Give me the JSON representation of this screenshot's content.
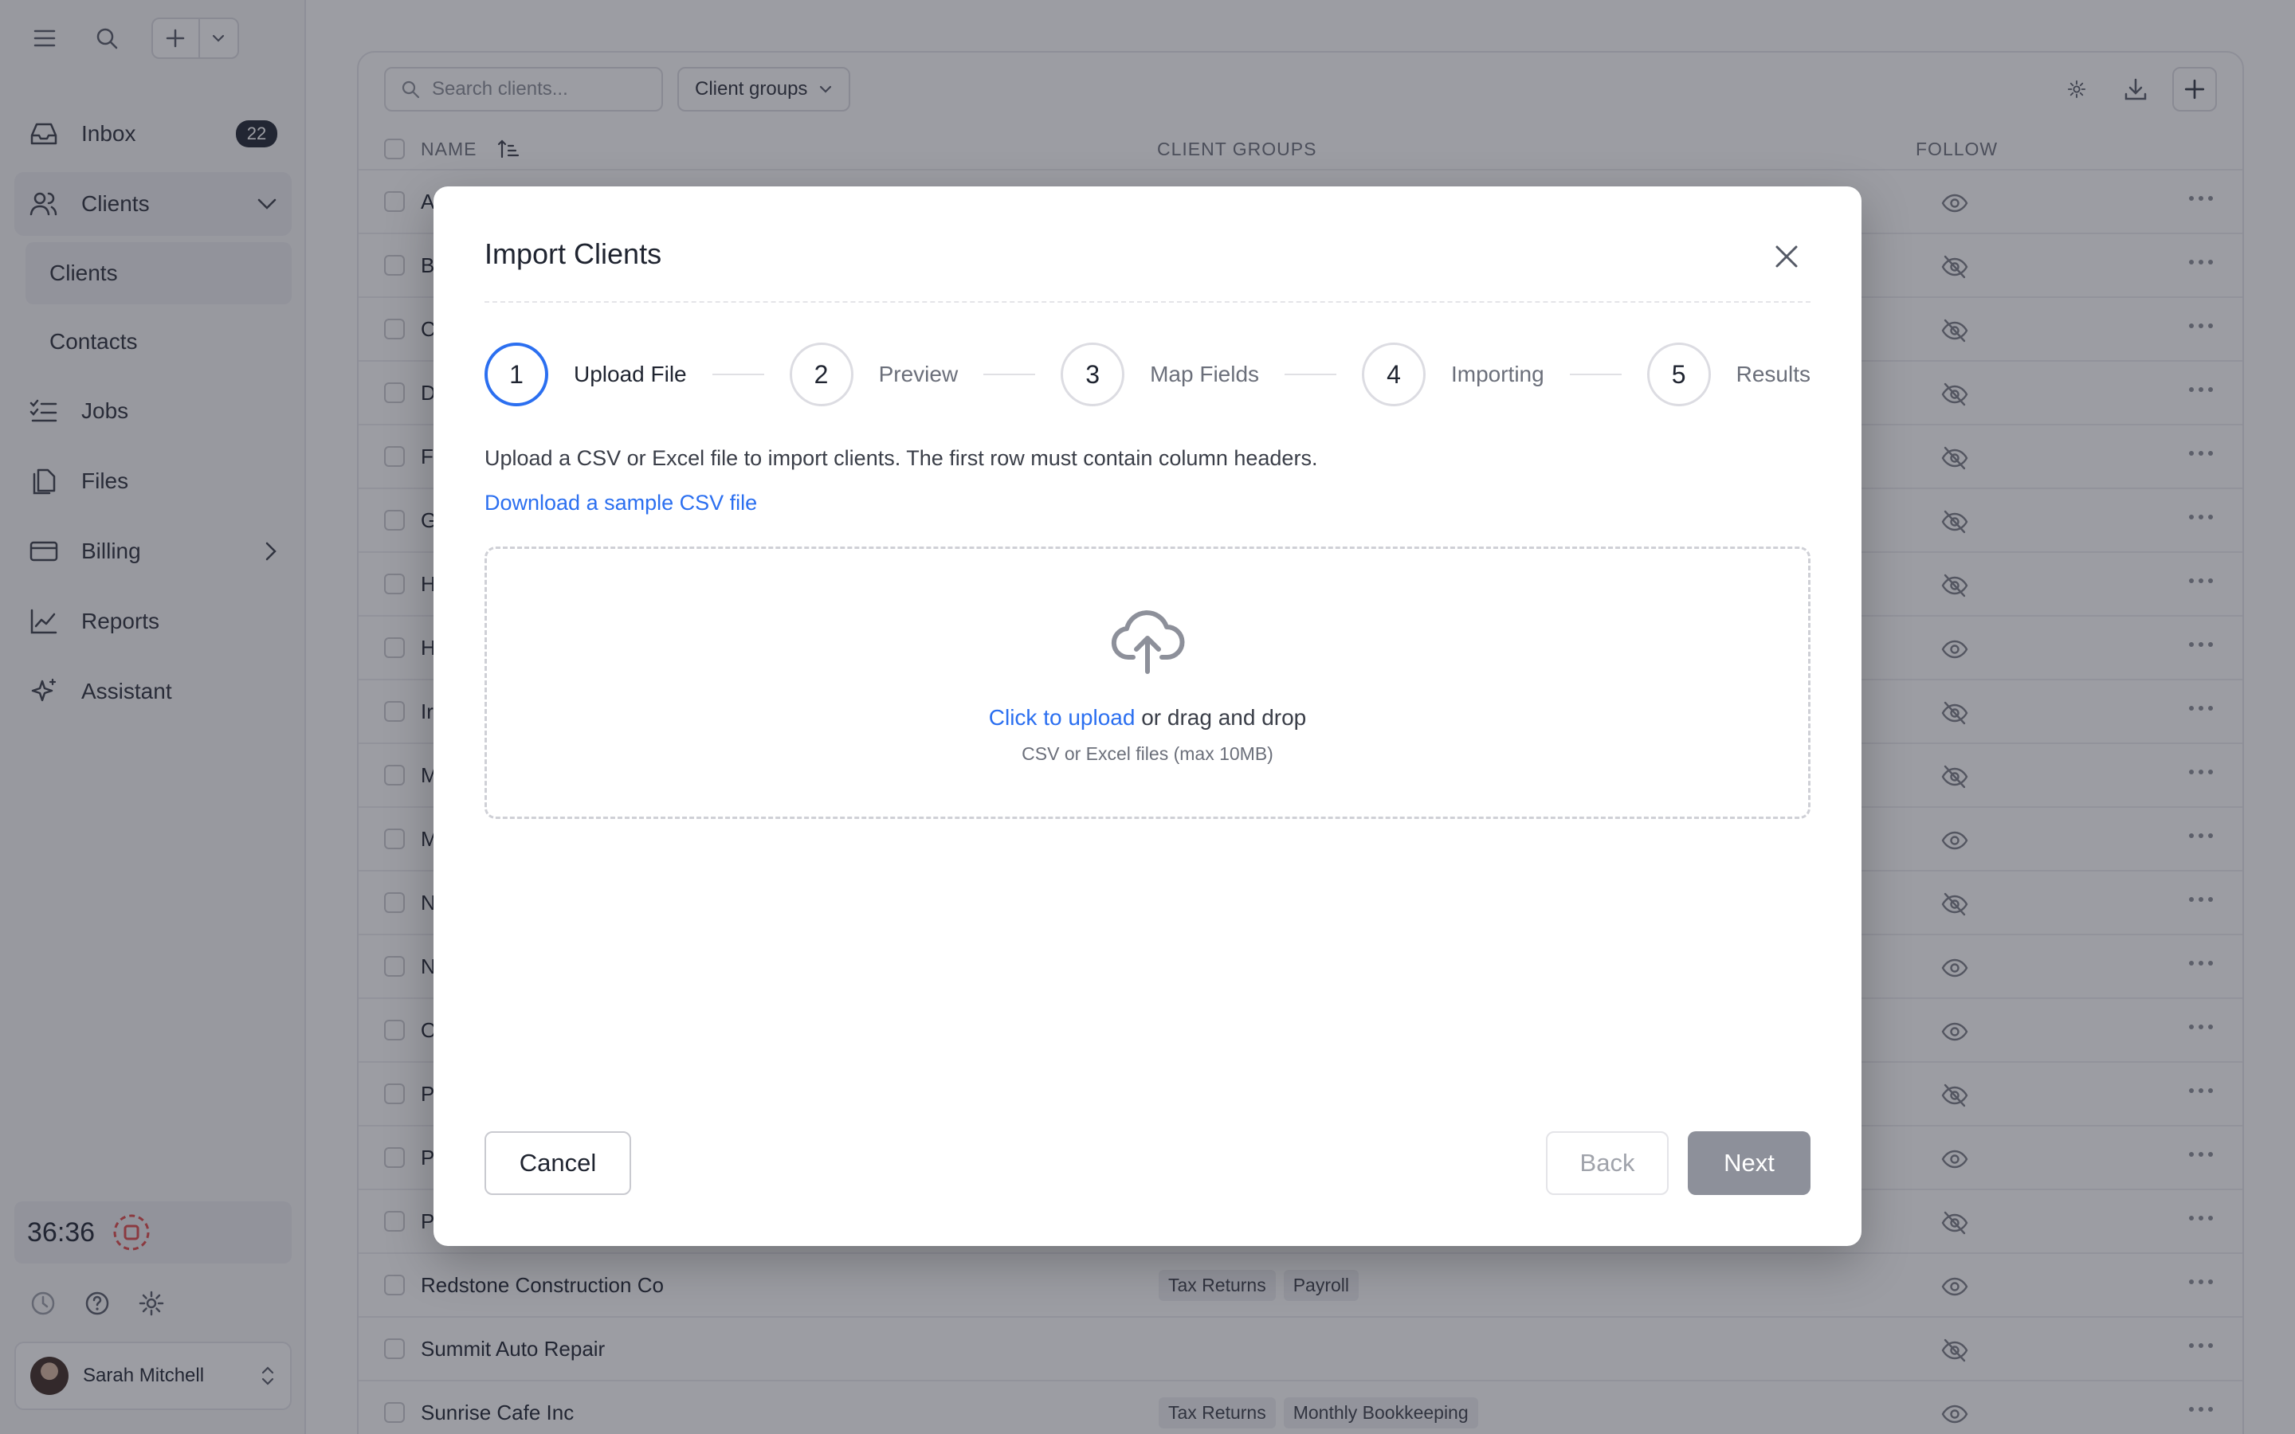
{
  "sidebar": {
    "nav": [
      {
        "label": "Inbox",
        "badge": "22"
      },
      {
        "label": "Clients"
      },
      {
        "label": "Jobs"
      },
      {
        "label": "Files"
      },
      {
        "label": "Billing"
      },
      {
        "label": "Reports"
      },
      {
        "label": "Assistant"
      }
    ],
    "sub": [
      "Clients",
      "Contacts"
    ],
    "timer": "36:36",
    "user": "Sarah Mitchell"
  },
  "list": {
    "search_placeholder": "Search clients...",
    "groups_label": "Client groups",
    "headers": {
      "name": "NAME",
      "groups": "CLIENT GROUPS",
      "follow": "FOLLOW"
    },
    "rows": [
      {
        "name": "A",
        "tags": [],
        "follow": true
      },
      {
        "name": "B",
        "tags": [],
        "follow": false
      },
      {
        "name": "C",
        "tags": [],
        "follow": false
      },
      {
        "name": "D",
        "tags": [],
        "follow": false
      },
      {
        "name": "Fu",
        "tags": [],
        "follow": false
      },
      {
        "name": "G",
        "tags": [],
        "follow": false
      },
      {
        "name": "H",
        "tags": [],
        "follow": false
      },
      {
        "name": "H",
        "tags": [],
        "follow": true
      },
      {
        "name": "Ir",
        "tags": [],
        "follow": false
      },
      {
        "name": "M",
        "tags": [],
        "follow": false
      },
      {
        "name": "M",
        "tags": [],
        "follow": true
      },
      {
        "name": "N",
        "tags": [],
        "follow": false
      },
      {
        "name": "N",
        "tags": [],
        "follow": true
      },
      {
        "name": "O",
        "tags": [],
        "follow": true
      },
      {
        "name": "Pa",
        "tags": [],
        "follow": false
      },
      {
        "name": "Pe",
        "tags": [],
        "follow": true
      },
      {
        "name": "Pr",
        "tags": [],
        "follow": false
      },
      {
        "name": "Redstone Construction Co",
        "tags": [
          "Tax Returns",
          "Payroll"
        ],
        "follow": true
      },
      {
        "name": "Summit Auto Repair",
        "tags": [],
        "follow": false
      },
      {
        "name": "Sunrise Cafe Inc",
        "tags": [
          "Tax Returns",
          "Monthly Bookkeeping"
        ],
        "follow": true
      }
    ]
  },
  "modal": {
    "title": "Import Clients",
    "steps": [
      {
        "num": "1",
        "label": "Upload File"
      },
      {
        "num": "2",
        "label": "Preview"
      },
      {
        "num": "3",
        "label": "Map Fields"
      },
      {
        "num": "4",
        "label": "Importing"
      },
      {
        "num": "5",
        "label": "Results"
      }
    ],
    "intro": "Upload a CSV or Excel file to import clients. The first row must contain column headers.",
    "sample_link": "Download a sample CSV file",
    "upload_click": "Click to upload",
    "upload_rest": " or drag and drop",
    "upload_hint": "CSV or Excel files (max 10MB)",
    "cancel": "Cancel",
    "back": "Back",
    "next": "Next"
  },
  "colors": {
    "accent": "#2b6ff0",
    "badge": "#1f2430",
    "timer_icon": "#e04848"
  }
}
